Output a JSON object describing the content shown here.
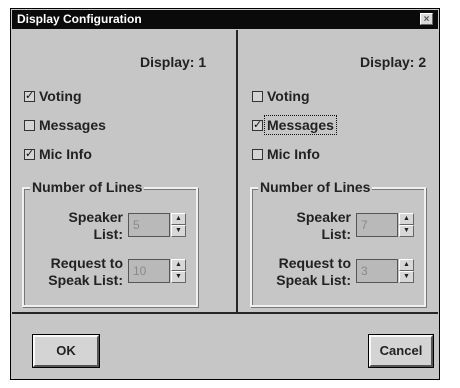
{
  "window": {
    "title": "Display Configuration",
    "close_glyph": "×"
  },
  "panels": [
    {
      "title": "Display: 1",
      "checkboxes": [
        {
          "label": "Voting",
          "checked": true
        },
        {
          "label": "Messages",
          "checked": false
        },
        {
          "label": "Mic Info",
          "checked": true
        }
      ],
      "group_title": "Number of Lines",
      "speaker_label_1": "Speaker",
      "speaker_label_2": "List:",
      "speaker_value": "5",
      "request_label_1": "Request to",
      "request_label_2": "Speak List:",
      "request_value": "10"
    },
    {
      "title": "Display: 2",
      "checkboxes": [
        {
          "label": "Voting",
          "checked": false
        },
        {
          "label": "Messages",
          "checked": true
        },
        {
          "label": "Mic Info",
          "checked": false
        }
      ],
      "group_title": "Number of Lines",
      "speaker_label_1": "Speaker",
      "speaker_label_2": "List:",
      "speaker_value": "7",
      "request_label_1": "Request to",
      "request_label_2": "Speak List:",
      "request_value": "3"
    }
  ],
  "buttons": {
    "ok": "OK",
    "cancel": "Cancel"
  },
  "icons": {
    "spin_up": "▲",
    "spin_down": "▼",
    "check": "✓"
  },
  "colors": {
    "dialog_bg": "#c6c6c6",
    "titlebar_bg": "#0a0a0a"
  }
}
